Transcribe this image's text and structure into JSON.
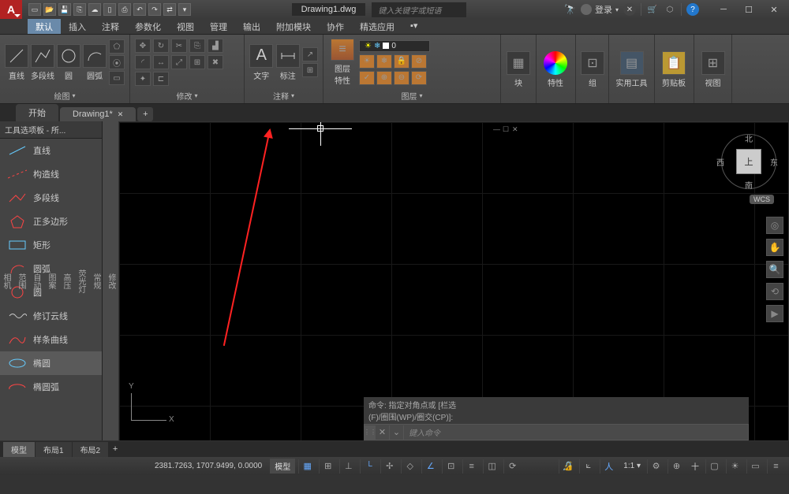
{
  "title": "Drawing1.dwg",
  "search_placeholder": "键入关键字或短语",
  "login_label": "登录",
  "menus": [
    "默认",
    "插入",
    "注释",
    "参数化",
    "视图",
    "管理",
    "输出",
    "附加模块",
    "协作",
    "精选应用"
  ],
  "active_menu": 0,
  "ribbon": {
    "draw": {
      "title": "绘图",
      "items": [
        "直线",
        "多段线",
        "圆",
        "圆弧"
      ]
    },
    "modify": {
      "title": "修改"
    },
    "annotate": {
      "title": "注释",
      "items": [
        "文字",
        "标注"
      ]
    },
    "layers": {
      "title": "图层",
      "item": "图层\n特性",
      "combo_value": "0"
    },
    "block": {
      "title": "块",
      "item": "块"
    },
    "properties": {
      "title": "特性"
    },
    "group": {
      "title": "组"
    },
    "utilities": {
      "title": "实用工具"
    },
    "clipboard": {
      "title": "剪贴板"
    },
    "view": {
      "title": "视图"
    }
  },
  "filetabs": {
    "start": "开始",
    "drawing": "Drawing1*"
  },
  "palette": {
    "header": "工具选项板 - 所...",
    "items": [
      "直线",
      "构造线",
      "多段线",
      "正多边形",
      "矩形",
      "圆弧",
      "圆",
      "修订云线",
      "样条曲线",
      "椭圆",
      "椭圆弧"
    ],
    "selected": 9,
    "side_tabs": [
      "修改",
      "常规",
      "荧光灯",
      "高压",
      "图案",
      "自动",
      "范围",
      "相机"
    ]
  },
  "navcube": {
    "face": "上",
    "n": "北",
    "s": "南",
    "e": "东",
    "w": "西",
    "wcs": "WCS"
  },
  "ucs": {
    "x": "X",
    "y": "Y"
  },
  "cmd": {
    "history1": "命令: 指定对角点或 [栏选",
    "history2": "(F)/圈围(WP)/圈交(CP)]:",
    "placeholder": "键入命令"
  },
  "layout_tabs": [
    "模型",
    "布局1",
    "布局2"
  ],
  "status": {
    "coords": "2381.7263, 1707.9499, 0.0000",
    "model": "模型",
    "scale": "1:1",
    "decimal": "十"
  }
}
